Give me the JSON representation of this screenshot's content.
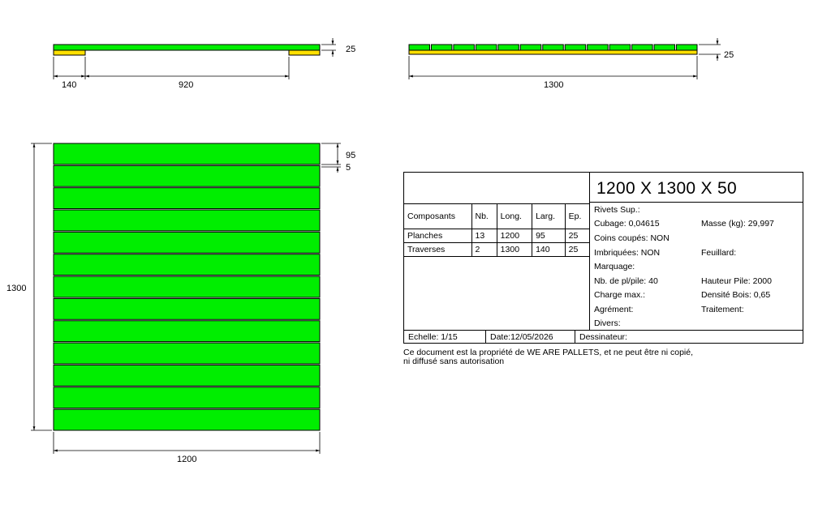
{
  "colors": {
    "plank": "#00ee00",
    "bearer": "#ffe000",
    "line": "#000000"
  },
  "side_view_left": {
    "thickness_label": "25",
    "bearer_label": "140",
    "gap_label": "920"
  },
  "side_view_right": {
    "thickness_label": "25",
    "length_label": "1300",
    "plank_count": 13
  },
  "top_view": {
    "plank_count": 13,
    "plank_width_label": "95",
    "gap_label": "5",
    "height_label": "1300",
    "width_label": "1200"
  },
  "cartouche": {
    "title": "1200 X 1300 X 50",
    "table": {
      "headers": [
        "Composants",
        "Nb.",
        "Long.",
        "Larg.",
        "Ep."
      ],
      "rows": [
        [
          "Planches",
          "13",
          "1200",
          "95",
          "25"
        ],
        [
          "Traverses",
          "2",
          "1300",
          "140",
          "25"
        ]
      ]
    },
    "info": {
      "rivets": "Rivets Sup.:",
      "cubage": "Cubage: 0,04615",
      "masse": "Masse (kg): 29,997",
      "coins": "Coins coupés: NON",
      "imbriquees": "Imbriquées: NON",
      "feuillard": "Feuillard:",
      "marquage": "Marquage:",
      "nb_pile": "Nb. de pl/pile: 40",
      "hauteur_pile": "Hauteur Pile: 2000",
      "charge": "Charge max.:",
      "densite": "Densité Bois: 0,65",
      "agrement": "Agrément:",
      "traitement": "Traitement:",
      "divers": "Divers:"
    },
    "footer": {
      "echelle": "Echelle: 1/15",
      "date": "Date:12/05/2026",
      "dessinateur": "Dessinateur:"
    }
  },
  "notice": {
    "line1": "Ce document est la propriété de WE ARE PALLETS, et ne peut être ni copié,",
    "line2": "ni diffusé sans autorisation"
  }
}
